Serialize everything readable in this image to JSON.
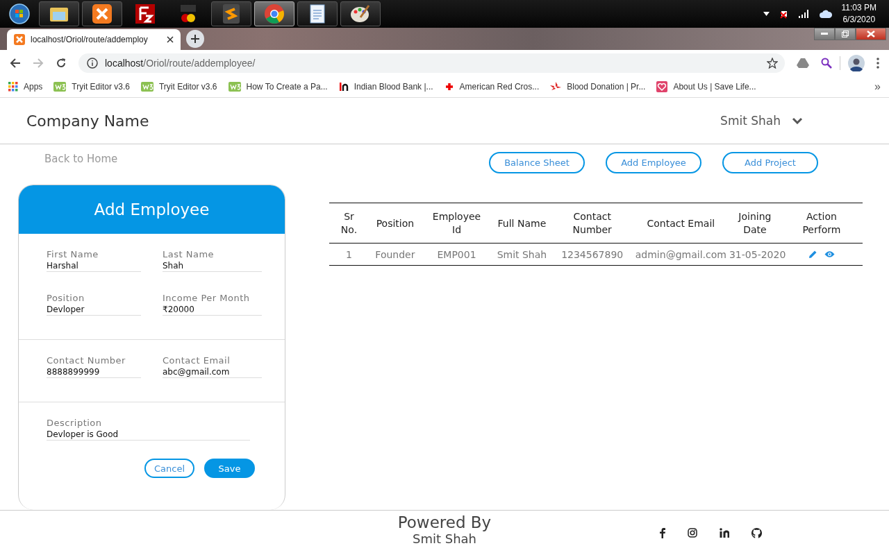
{
  "taskbar": {
    "time": "11:03 PM",
    "date": "6/3/2020"
  },
  "browser": {
    "tab_title": "localhost/Oriol/route/addemploy",
    "url_host": "localhost",
    "url_path": "/Oriol/route/addemployee/",
    "bookmarks": [
      {
        "kind": "grid",
        "label": "Apps"
      },
      {
        "kind": "w3",
        "label": "Tryit Editor v3.6"
      },
      {
        "kind": "w3",
        "label": "Tryit Editor v3.6"
      },
      {
        "kind": "w3",
        "label": "How To Create a Pa..."
      },
      {
        "kind": "in",
        "label": "Indian Blood Bank |..."
      },
      {
        "kind": "cross",
        "label": "American Red Cros..."
      },
      {
        "kind": "drop",
        "label": "Blood Donation | Pr..."
      },
      {
        "kind": "heart",
        "label": "About Us | Save Life..."
      }
    ],
    "more": "»"
  },
  "header": {
    "company": "Company Name",
    "user": "Smit Shah"
  },
  "back_link": "Back to Home",
  "nav_buttons": [
    "Balance Sheet",
    "Add Employee",
    "Add Project"
  ],
  "form": {
    "title": "Add Employee",
    "sections": [
      [
        {
          "label": "First Name",
          "value": "Harshal"
        },
        {
          "label": "Last Name",
          "value": "Shah"
        },
        {
          "label": "Position",
          "value": "Devloper"
        },
        {
          "label": "Income Per Month",
          "value": "₹20000"
        }
      ],
      [
        {
          "label": "Contact Number",
          "value": "8888899999"
        },
        {
          "label": "Contact Email",
          "value": "abc@gmail.com"
        }
      ],
      [
        {
          "label": "Description",
          "value": "Devloper is Good"
        }
      ]
    ],
    "cancel": "Cancel",
    "save": "Save"
  },
  "table": {
    "columns": [
      "Sr No.",
      "Position",
      "Employee Id",
      "Full Name",
      "Contact Number",
      "Contact Email",
      "Joining Date",
      "Action Perform"
    ],
    "rows": [
      [
        "1",
        "Founder",
        "EMP001",
        "Smit Shah",
        "1234567890",
        "admin@gmail.com",
        "31-05-2020"
      ]
    ]
  },
  "footer": {
    "title": "Powered By",
    "name": "Smit Shah"
  }
}
